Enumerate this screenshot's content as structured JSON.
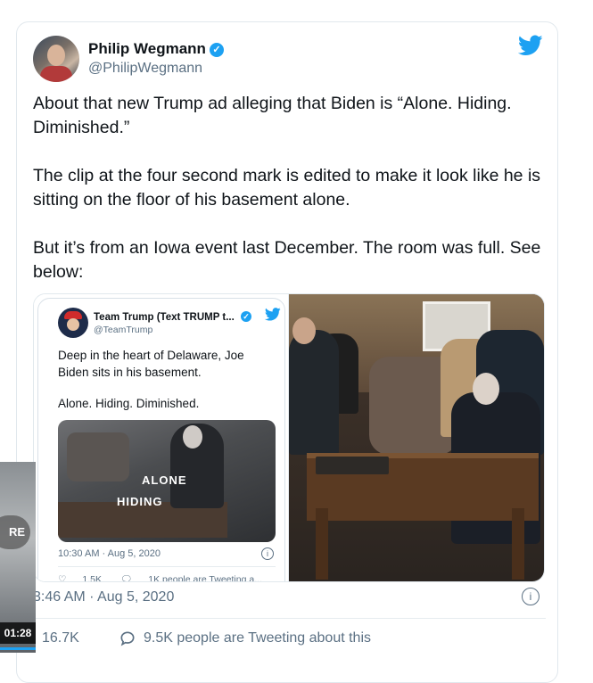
{
  "tweet": {
    "author_name": "Philip Wegmann",
    "author_handle": "@PhilipWegmann",
    "paragraphs": [
      "About that new Trump ad alleging that Biden is “Alone. Hiding. Diminished.”",
      "The clip at the four second mark is edited to make it look like he is sitting on the floor of his basement alone.",
      "But it’s from an Iowa event last December. The room was full. See below:"
    ],
    "time": "3:46 AM · Aug 5, 2020",
    "likes": "16.7K",
    "tweeting": "9.5K people are Tweeting about this"
  },
  "embed": {
    "author_name": "Team Trump (Text TRUMP t...",
    "author_handle": "@TeamTrump",
    "paragraphs": [
      "Deep in the heart of Delaware, Joe Biden sits in his basement.",
      "Alone. Hiding. Diminished."
    ],
    "caption_1": "ALONE",
    "caption_2": "HIDING",
    "time": "10:30 AM · Aug 5, 2020",
    "likes": "1.5K",
    "tweeting": "1K people are Tweeting a..."
  },
  "video": {
    "label": "RE",
    "duration": "01:28"
  },
  "colors": {
    "accent": "#1da1f2",
    "muted": "#5b7083",
    "text": "#0f1419"
  }
}
